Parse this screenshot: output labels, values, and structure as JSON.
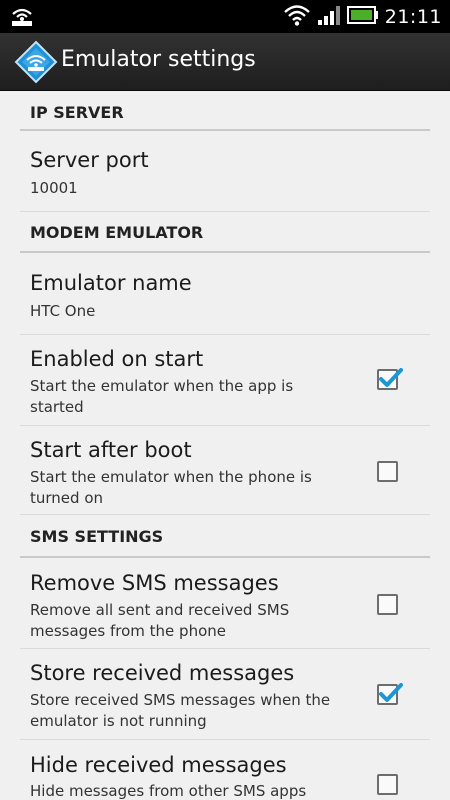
{
  "status_bar": {
    "time": "21:11",
    "icons": [
      "wifi-tether-icon",
      "wifi-icon",
      "signal-icon",
      "battery-icon"
    ],
    "battery_color": "#4caf2a"
  },
  "action_bar": {
    "title": "Emulator settings",
    "icon": "network-app-icon",
    "accent_color": "#1f8fd6"
  },
  "sections": {
    "ip_server": {
      "header": "IP SERVER",
      "server_port": {
        "title": "Server port",
        "summary": "10001"
      }
    },
    "modem_emulator": {
      "header": "MODEM EMULATOR",
      "emulator_name": {
        "title": "Emulator name",
        "summary": "HTC One"
      },
      "enabled_on_start": {
        "title": "Enabled on start",
        "summary": "Start the emulator when the app is started",
        "checked": true
      },
      "start_after_boot": {
        "title": "Start after boot",
        "summary": "Start the emulator when the phone is turned on",
        "checked": false
      }
    },
    "sms_settings": {
      "header": "SMS SETTINGS",
      "remove_sms": {
        "title": "Remove SMS messages",
        "summary": "Remove all sent and received SMS messages from the phone",
        "checked": false
      },
      "store_received": {
        "title": "Store received messages",
        "summary": "Store received SMS messages when the emulator is not running",
        "checked": true
      },
      "hide_received": {
        "title": "Hide received messages",
        "summary": "Hide messages from other SMS apps",
        "checked": false
      }
    }
  },
  "check_color": "#1a98d6"
}
